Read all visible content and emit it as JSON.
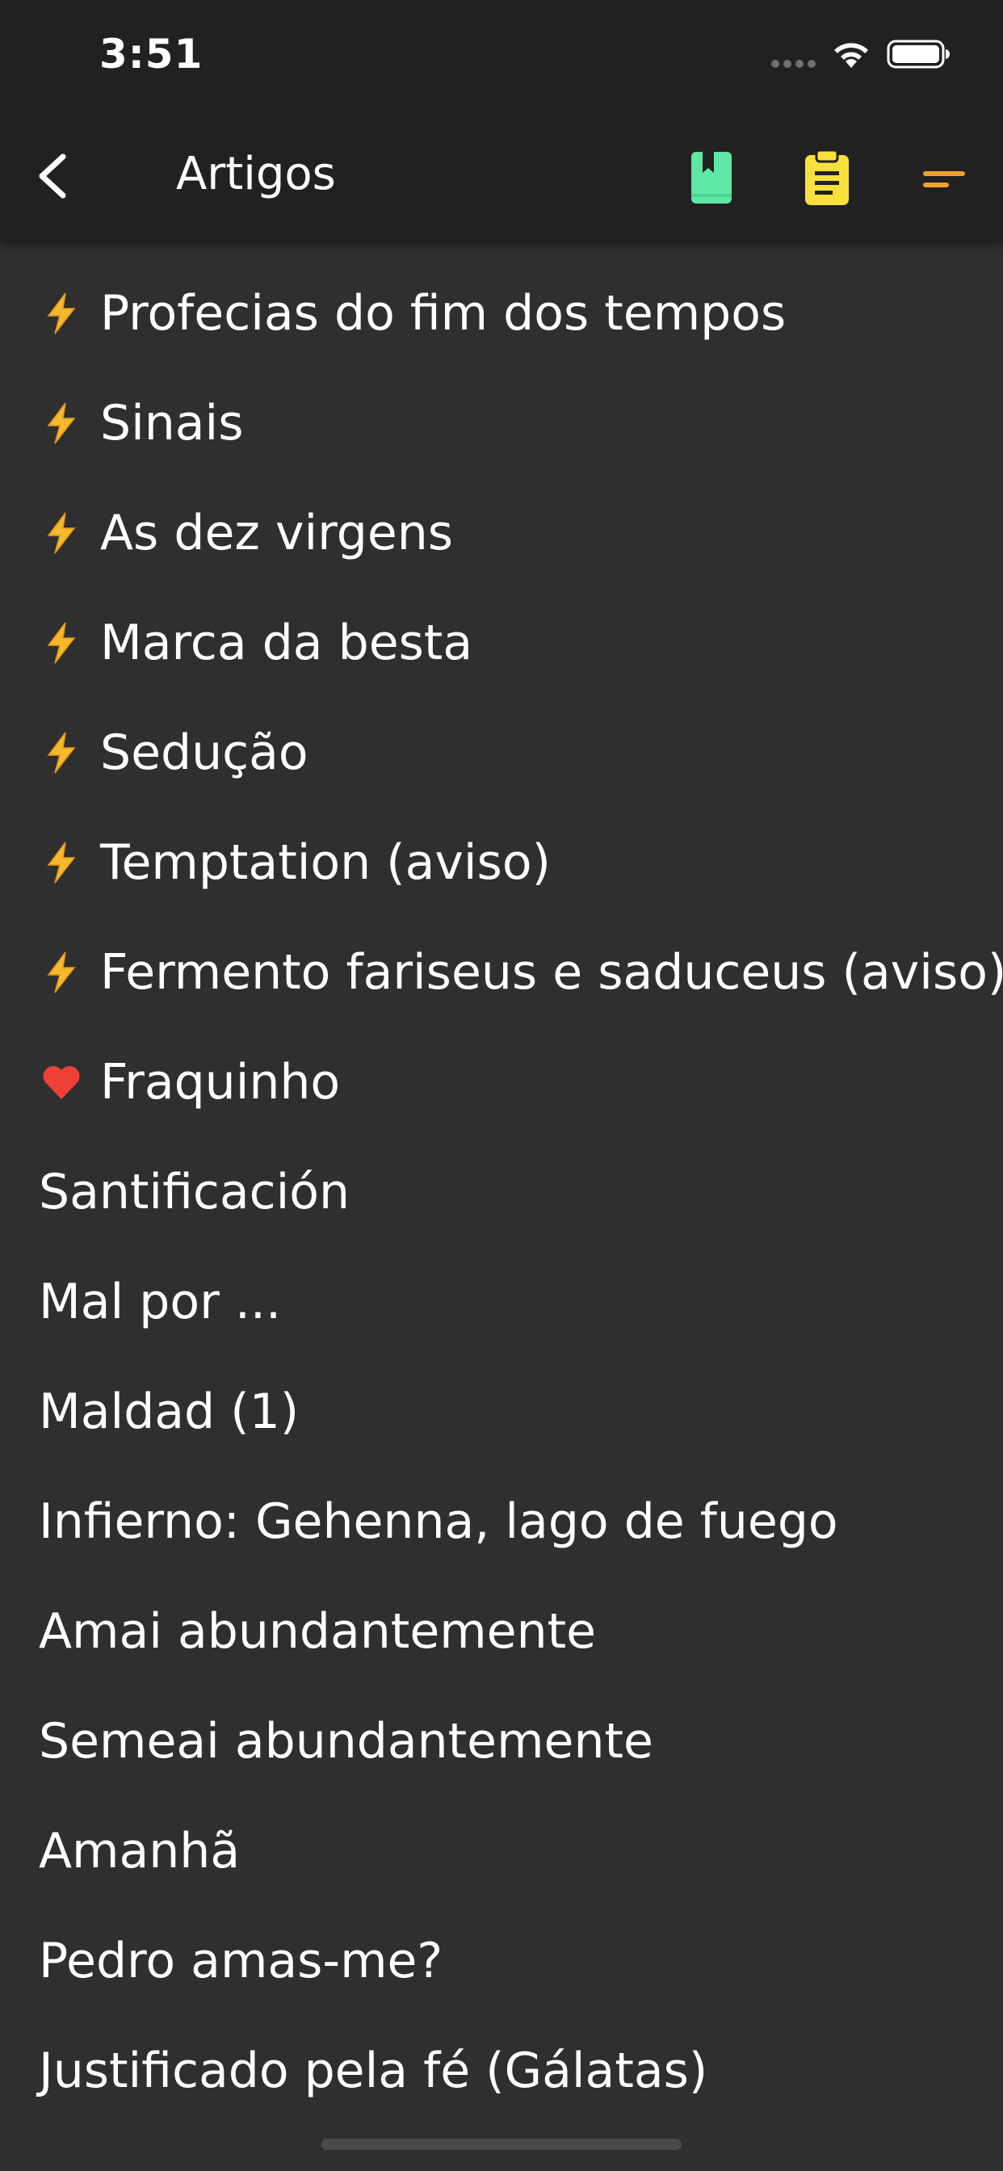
{
  "status": {
    "time": "3:51"
  },
  "nav": {
    "title": "Artigos",
    "icons": {
      "back": "chevron-left-icon",
      "bookmark": "book-bookmark-icon",
      "clipboard": "clipboard-list-icon",
      "sort": "sort-lines-icon"
    },
    "colors": {
      "bookmark": "#5ee8a6",
      "clipboard": "#f9e03c",
      "sort": "#f0a030"
    }
  },
  "articles": [
    {
      "icon": "lightning-icon",
      "title": "Profecias do fim dos tempos"
    },
    {
      "icon": "lightning-icon",
      "title": "Sinais"
    },
    {
      "icon": "lightning-icon",
      "title": "As dez virgens"
    },
    {
      "icon": "lightning-icon",
      "title": "Marca da besta"
    },
    {
      "icon": "lightning-icon",
      "title": "Sedução"
    },
    {
      "icon": "lightning-icon",
      "title": "Temptation (aviso)"
    },
    {
      "icon": "lightning-icon",
      "title": "Fermento fariseus e saduceus (aviso)"
    },
    {
      "icon": "heart-icon",
      "title": "Fraquinho"
    },
    {
      "icon": "",
      "title": "Santificación"
    },
    {
      "icon": "",
      "title": "Mal por ..."
    },
    {
      "icon": "",
      "title": "Maldad (1)"
    },
    {
      "icon": "",
      "title": "Infierno: Gehenna, lago de fuego"
    },
    {
      "icon": "",
      "title": "Amai abundantemente"
    },
    {
      "icon": "",
      "title": "Semeai abundantemente"
    },
    {
      "icon": "",
      "title": "Amanhã"
    },
    {
      "icon": "",
      "title": "Pedro amas-me?"
    },
    {
      "icon": "",
      "title": "Justificado pela fé (Gálatas)"
    }
  ]
}
